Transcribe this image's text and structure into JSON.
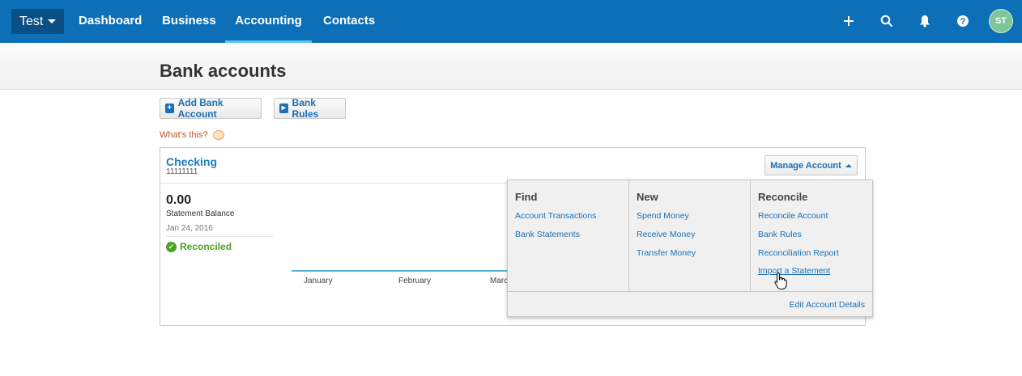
{
  "topnav": {
    "org": "Test",
    "links": [
      "Dashboard",
      "Business",
      "Accounting",
      "Contacts"
    ],
    "active": "Accounting",
    "icons": [
      "plus-icon",
      "search-icon",
      "bell-icon",
      "help-icon"
    ],
    "avatar": "ST",
    "colors": {
      "bar": "#0d6fb8",
      "active_underline": "#58c5f0"
    }
  },
  "page": {
    "title": "Bank accounts"
  },
  "toolbar": {
    "add_bank_account": "Add Bank Account",
    "bank_rules": "Bank Rules",
    "whats_this": "What's this?"
  },
  "account": {
    "name": "Checking",
    "number": "11111111",
    "manage": "Manage Account",
    "balance": "0.00",
    "balance_label": "Statement Balance",
    "date": "Jan 24, 2016",
    "status": "Reconciled",
    "months": [
      "January",
      "February",
      "Marc"
    ]
  },
  "manage_menu": {
    "find": {
      "heading": "Find",
      "links": [
        "Account Transactions",
        "Bank Statements"
      ]
    },
    "new": {
      "heading": "New",
      "links": [
        "Spend Money",
        "Receive Money",
        "Transfer Money"
      ]
    },
    "reconcile": {
      "heading": "Reconcile",
      "links": [
        "Reconcile Account",
        "Bank Rules",
        "Reconciliation Report",
        "Import a Statement"
      ]
    },
    "footer": "Edit Account Details"
  }
}
